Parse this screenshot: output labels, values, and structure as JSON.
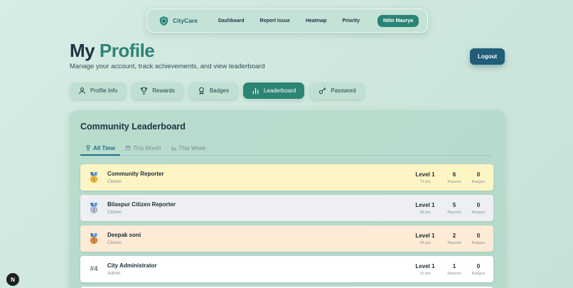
{
  "nav": {
    "brand": "CityCare",
    "links": [
      "Dashboard",
      "Report Issue",
      "Heatmap",
      "Priority"
    ],
    "user": "Nitin Maurya"
  },
  "header": {
    "title_part1": "My",
    "title_part2": "Profile",
    "subtitle": "Manage your account, track achievements, and view leaderboard",
    "logout_label": "Logout"
  },
  "tabs": [
    {
      "label": "Profile Info",
      "icon": "user-icon",
      "active": false
    },
    {
      "label": "Rewards",
      "icon": "trophy-icon",
      "active": false
    },
    {
      "label": "Badges",
      "icon": "award-icon",
      "active": false
    },
    {
      "label": "Leaderboard",
      "icon": "bar-chart-icon",
      "active": true
    },
    {
      "label": "Password",
      "icon": "key-icon",
      "active": false
    }
  ],
  "leaderboard": {
    "title": "Community Leaderboard",
    "periods": [
      {
        "label": "All Time",
        "icon": "trophy-icon",
        "active": true
      },
      {
        "label": "This Month",
        "icon": "calendar-icon",
        "active": false
      },
      {
        "label": "This Week",
        "icon": "chart-icon",
        "active": false
      }
    ],
    "entries": [
      {
        "rank": "1",
        "name": "Community Reporter",
        "role": "Citizen",
        "level": "Level 1",
        "points": "70 pts",
        "reports": "6",
        "reports_label": "Reports",
        "badges": "0",
        "badges_label": "Badges",
        "bg": "#fdf5c4",
        "medal": "gold-medal-icon"
      },
      {
        "rank": "2",
        "name": "Bilaspur Citizen Reporter",
        "role": "Citizen",
        "level": "Level 1",
        "points": "55 pts",
        "reports": "5",
        "reports_label": "Reports",
        "badges": "0",
        "badges_label": "Badges",
        "bg": "#eeeff3",
        "medal": "silver-medal-icon"
      },
      {
        "rank": "3",
        "name": "Deepak soni",
        "role": "Citizen",
        "level": "Level 1",
        "points": "28 pts",
        "reports": "2",
        "reports_label": "Reports",
        "badges": "0",
        "badges_label": "Badges",
        "bg": "#fdebd6",
        "medal": "bronze-medal-icon"
      },
      {
        "rank": "#4",
        "name": "City Administrator",
        "role": "Admin",
        "level": "Level 1",
        "points": "10 pts",
        "reports": "1",
        "reports_label": "Reports",
        "badges": "0",
        "badges_label": "Badges",
        "bg": "#ffffff",
        "medal": ""
      }
    ]
  },
  "fab_label": "N",
  "colors": {
    "accent": "#2c8474",
    "dark_button": "#1f5d78",
    "title_dark": "#1c3344"
  }
}
